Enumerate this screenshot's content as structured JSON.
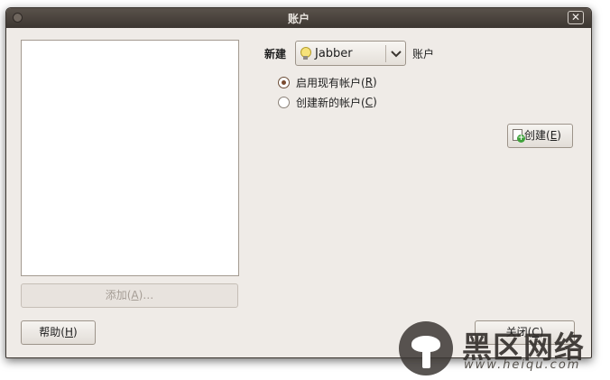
{
  "window": {
    "title": "账户",
    "close_glyph": "✕"
  },
  "new_account": {
    "label": "新建",
    "protocol": "Jabber",
    "suffix_label": "账户",
    "options": [
      {
        "text": "启用现有帐户(",
        "mnemonic": "R",
        "tail": ")",
        "selected": true
      },
      {
        "text": "创建新的帐户(",
        "mnemonic": "C",
        "tail": ")",
        "selected": false
      }
    ],
    "create_button": {
      "text": "创建(",
      "mnemonic": "E",
      "tail": ")"
    }
  },
  "buttons": {
    "add": {
      "text": "添加(",
      "mnemonic": "A",
      "tail": ")…",
      "enabled": false
    },
    "help": {
      "text": "帮助(",
      "mnemonic": "H",
      "tail": ")"
    },
    "close": {
      "text": "关闭(",
      "mnemonic": "C",
      "tail": ")"
    }
  },
  "watermark": {
    "brand": "黑区网络",
    "url": "www.heiqu.com"
  },
  "icons": [
    "window-menu-icon",
    "close-icon",
    "lightbulb-icon",
    "chevron-down-icon",
    "add-page-icon"
  ]
}
